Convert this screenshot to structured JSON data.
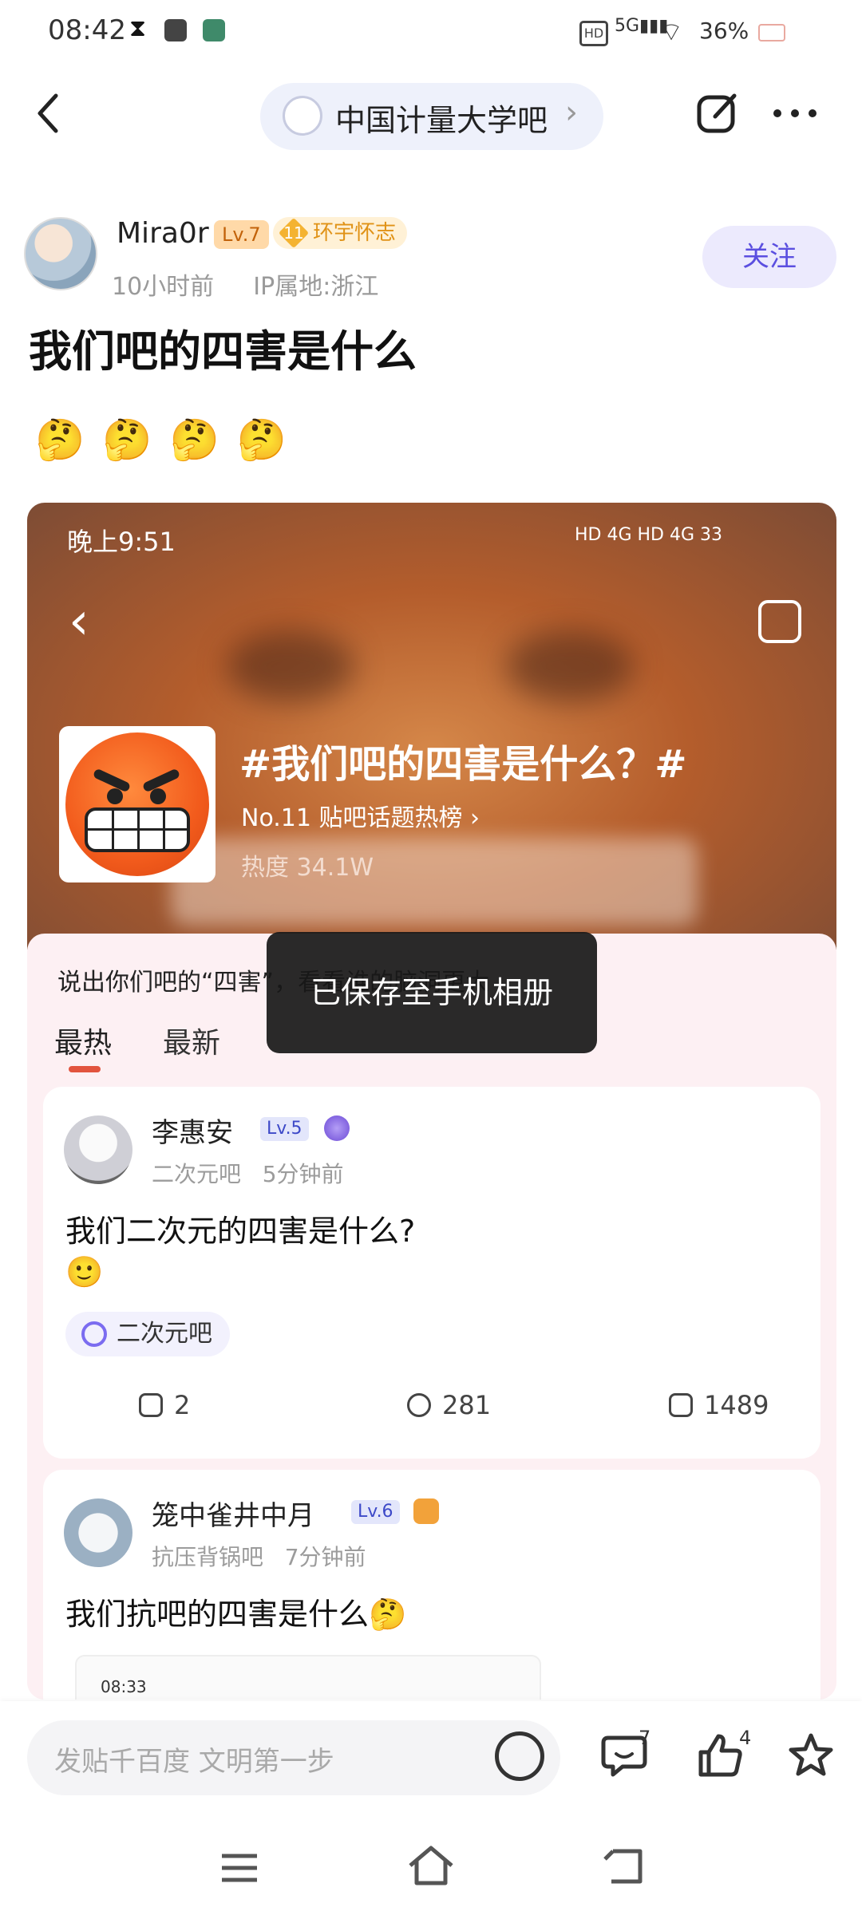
{
  "status_bar": {
    "time": "08:42",
    "network": "5G",
    "battery": "36%"
  },
  "nav": {
    "back_icon": "chevron-left",
    "forum_name": "中国计量大学吧",
    "forum_chevron": "›",
    "share_icon": "share-icon",
    "more_icon": "⋯"
  },
  "author": {
    "name": "Mira0r",
    "level": "Lv.7",
    "medal_num": "11",
    "medal_label": "环宇怀志",
    "time": "10小时前",
    "ip": "IP属地:浙江",
    "follow_label": "关注"
  },
  "post": {
    "title": "我们吧的四害是什么",
    "emojis": "🤔🤔🤔🤔"
  },
  "embedded": {
    "status_time": "晚上9:51",
    "status_icons": "HD 4G HD 4G 33",
    "topic": "#我们吧的四害是什么？#",
    "rank": "No.11 贴吧话题热榜 ›",
    "heat": "热度 34.1W",
    "prompt": "说出你们吧的“四害”，看看谁的脑洞更大",
    "tab_hot": "最热",
    "tab_new": "最新",
    "cards": [
      {
        "name": "李惠安",
        "level": "Lv.5",
        "forum": "二次元吧",
        "time": "5分钟前",
        "text": "我们二次元的四害是什么?",
        "emoji": "🙂",
        "tag": "二次元吧",
        "share": "2",
        "comments": "281",
        "likes": "1489"
      },
      {
        "name": "笼中雀井中月",
        "level": "Lv.6",
        "forum": "抗压背锅吧",
        "time": "7分钟前",
        "text": "我们抗吧的四害是什么🤔",
        "inner_time": "08:33"
      }
    ]
  },
  "toast": "已保存至手机相册",
  "bottom": {
    "input_placeholder": "发贴千百度 文明第一步",
    "comment_count": "7",
    "like_count": "4"
  }
}
